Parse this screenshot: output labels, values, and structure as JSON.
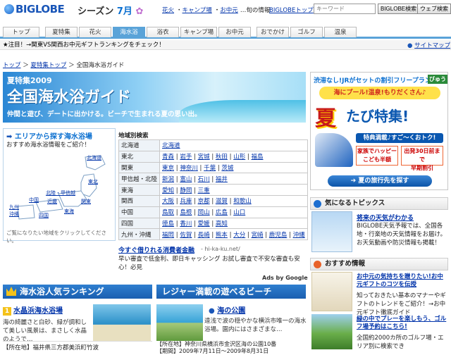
{
  "header": {
    "logo": "BIGLOBE",
    "season_label": "シーズン",
    "month": "7月",
    "links": [
      "花火",
      "キャンプ場",
      "お中元"
    ],
    "links_suffix": "…旬の情報",
    "biglobe_top": "BIGLOBEトップ",
    "search_placeholder": "キーワード",
    "search_biglobe": "BIGLOBE検索",
    "search_web": "ウェブ検索"
  },
  "nav": {
    "tabs": [
      "トップ",
      "夏特集",
      "花火",
      "海水浴",
      "浴衣",
      "キャンプ場",
      "お中元",
      "おでかけ",
      "ゴルフ",
      "温泉"
    ],
    "active": "海水浴"
  },
  "notice": {
    "text": "★注目！→関東VS関西お中元ギフトランキングをチェック！",
    "sitemap": "サイトマップ"
  },
  "breadcrumb": {
    "home": "トップ",
    "parent": "夏特集トップ",
    "current": "全国海水浴ガイド"
  },
  "hero": {
    "year": "夏特集2009",
    "title": "全国海水浴ガイド",
    "subtitle": "仲間と遊び、デートに出かける。ビーチで生まれる夏の思い出。"
  },
  "map": {
    "title": "エリアから探す海水浴場",
    "subtitle": "おすすめ海水浴情報をご紹介！",
    "regions": [
      "北海道",
      "東北",
      "北陸・甲信越",
      "関東",
      "東海",
      "近畿",
      "中国",
      "四国",
      "九州",
      "沖縄"
    ],
    "note": "ご覧になりたい地域をクリックしてください。"
  },
  "region_search": {
    "title": "地域別検索",
    "rows": [
      {
        "area": "北海道",
        "prefs": [
          "北海道"
        ]
      },
      {
        "area": "東北",
        "prefs": [
          "青森",
          "岩手",
          "宮城",
          "秋田",
          "山形",
          "福島"
        ]
      },
      {
        "area": "関東",
        "prefs": [
          "東京",
          "神奈川",
          "千葉",
          "茨城"
        ]
      },
      {
        "area": "甲信越・北陸",
        "prefs": [
          "新潟",
          "富山",
          "石川",
          "福井"
        ]
      },
      {
        "area": "東海",
        "prefs": [
          "愛知",
          "静岡",
          "三重"
        ]
      },
      {
        "area": "関西",
        "prefs": [
          "大阪",
          "兵庫",
          "京都",
          "滋賀",
          "和歌山"
        ]
      },
      {
        "area": "中国",
        "prefs": [
          "鳥取",
          "島根",
          "岡山",
          "広島",
          "山口"
        ]
      },
      {
        "area": "四国",
        "prefs": [
          "徳島",
          "香川",
          "愛媛",
          "高知"
        ]
      },
      {
        "area": "九州・沖縄",
        "prefs": [
          "福岡",
          "佐賀",
          "長崎",
          "熊本",
          "大分",
          "宮崎",
          "鹿児島",
          "沖縄"
        ]
      }
    ]
  },
  "ad": {
    "link": "今すぐ借りれる消費者金融",
    "url": "- hi-ka-ku.net/",
    "text": "早い審査で低金利、即日キャッシング お試し審査で不安な審査も安心！必見",
    "ads_by": "Ads by Google"
  },
  "ranking": {
    "heading": "海水浴人気ランキング",
    "rank": "1",
    "name": "水晶浜海水浴場",
    "desc": "海の綺麗さと白砂、緑が調和して美しい風景は、まさしく水晶のようで…",
    "location": "【所在地】福井県三方郡美浜町竹波"
  },
  "leisure": {
    "heading": "レジャー満載の遊べるビーチ",
    "name": "海の公園",
    "desc": "遠浅で波の穏やかな横浜市唯一の海水浴場。園内にはさまざまな…",
    "address": "【所在地】神奈川県横浜市金沢区海の公園10番",
    "period": "【期間】2009年7月11日～2009年8月31日"
  },
  "right_banner": {
    "line1": "渋滞なし!JRがセットの割引フリープラン",
    "brand": "びゅう",
    "pill": "海にプール!温泉!もりだくさん♪",
    "big": "夏",
    "big2": "たび特集!",
    "train_pill": "特典満載♪すご～くおトク!",
    "promo1a": "家族でハッピー",
    "promo1b": "こども半額",
    "promo2a": "出発30日前まで",
    "promo2b": "早期割引",
    "cta": "夏の旅行先を探す"
  },
  "topics": {
    "heading": "気になるトピックス",
    "title": "将来の天気がわかる",
    "text": "BIGLOBE天気予報では、全国各地・行楽地の天気情報をお届け。お天気動画や防災情報も掲載！"
  },
  "recommend": {
    "heading": "おすすめ情報",
    "item1_title": "お中元の気持ちを贈りたい!お中元ギフトのコツを伝授",
    "item1_text": "知っておきたい基本のマナーやギフトのトレンドをご紹介！→お中元ギフト徹底ガイド",
    "item2_title": "緑の中でプレーを楽しもう、ゴルフ場予約はこちら!",
    "item2_text": "全国約2000カ所のゴルフ場・エリア別に検索でき"
  }
}
